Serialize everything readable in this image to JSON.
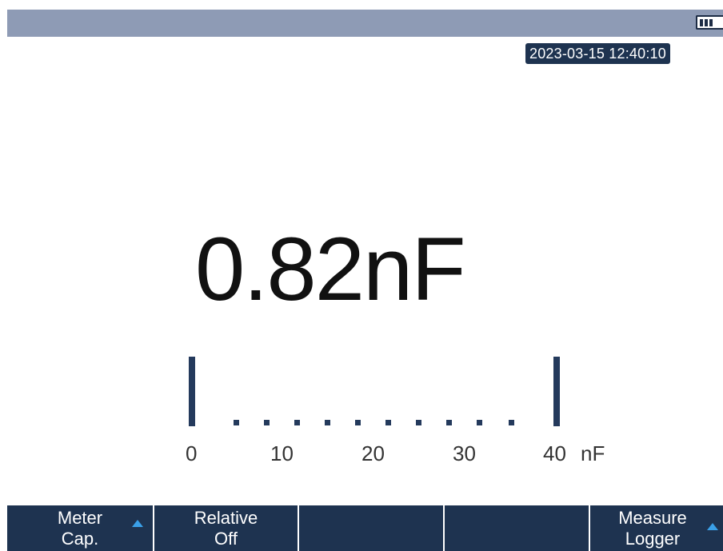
{
  "status": {
    "datetime": "2023-03-15 12:40:10",
    "battery_icon": "battery-icon",
    "battery_level": 0.75
  },
  "meter": {
    "reading": "0.82nF",
    "scale": {
      "labels": [
        "0",
        "10",
        "20",
        "30",
        "40"
      ],
      "unit": "nF",
      "min": 0,
      "max": 40
    }
  },
  "softkeys": [
    {
      "line1": "Meter",
      "line2": "Cap.",
      "has_arrow": true
    },
    {
      "line1": "Relative",
      "line2": "Off",
      "has_arrow": false
    },
    {
      "line1": "",
      "line2": "",
      "has_arrow": false
    },
    {
      "line1": "",
      "line2": "",
      "has_arrow": false
    },
    {
      "line1": "Measure",
      "line2": "Logger",
      "has_arrow": true
    }
  ],
  "colors": {
    "top_bar": "#8e9bb5",
    "softkey_bg": "#1e3350",
    "scale_marks": "#243a5c",
    "arrow_accent": "#3aa0e8"
  }
}
